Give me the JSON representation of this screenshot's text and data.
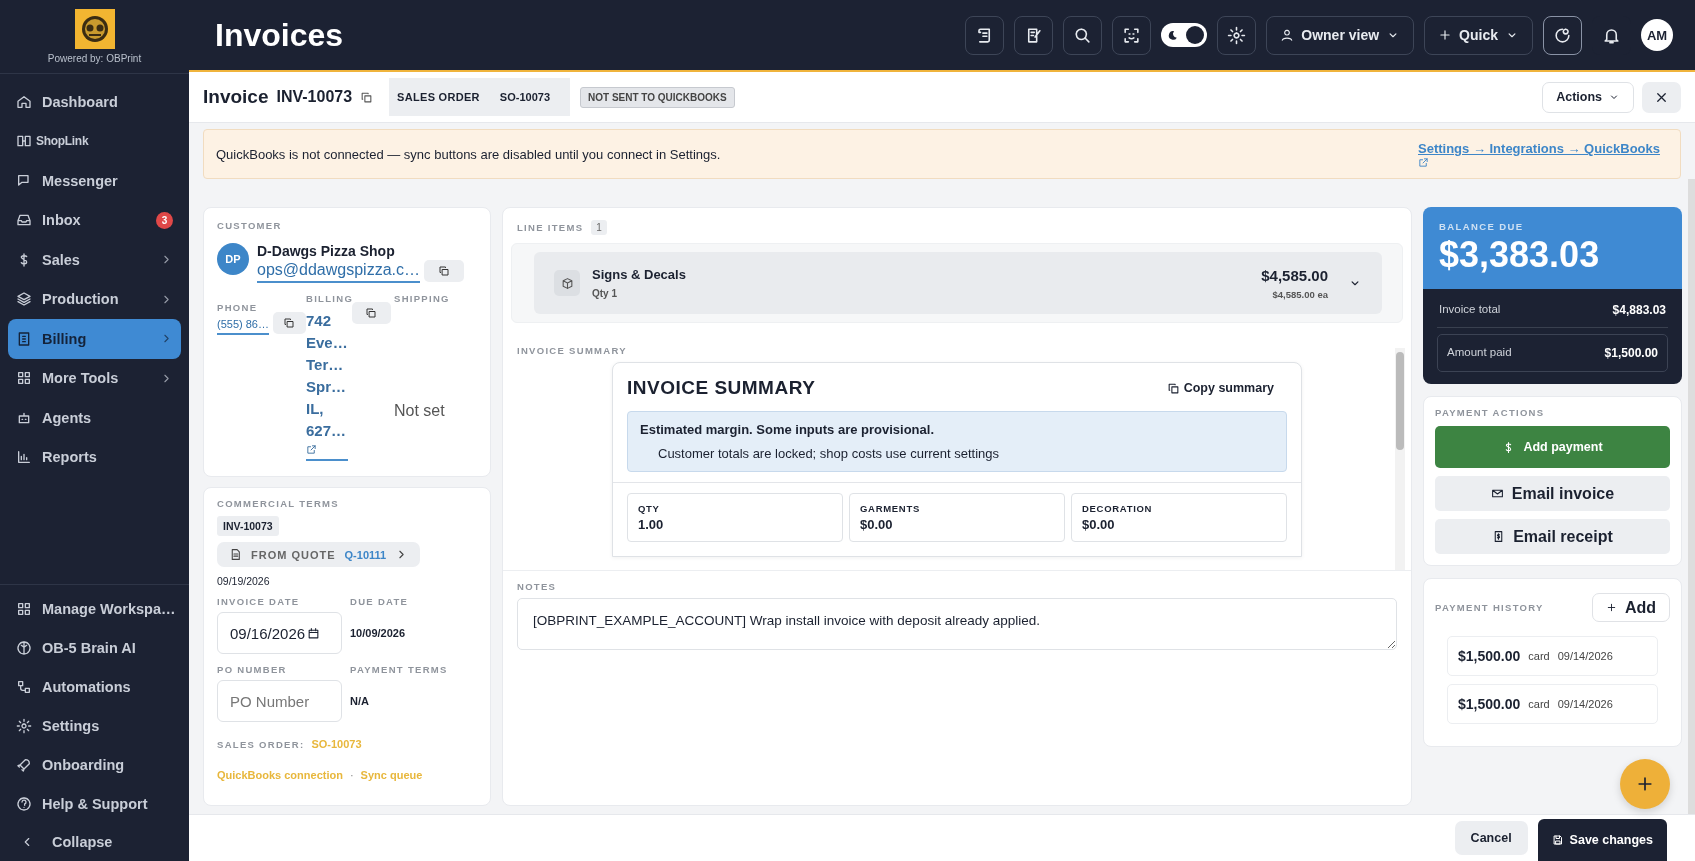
{
  "sidebar": {
    "tagline": "Powered by: OBPrint",
    "items": [
      {
        "label": "Dashboard",
        "kind": "link",
        "selected": false,
        "expandable": false
      },
      {
        "label": "ShopLink",
        "kind": "logo",
        "selected": false,
        "expandable": false
      },
      {
        "label": "Messenger",
        "kind": "link",
        "selected": false,
        "expandable": false
      },
      {
        "label": "Inbox",
        "kind": "link",
        "selected": false,
        "expandable": false,
        "badge": "3"
      },
      {
        "label": "Sales",
        "kind": "link",
        "selected": false,
        "expandable": true
      },
      {
        "label": "Production",
        "kind": "link",
        "selected": false,
        "expandable": true
      },
      {
        "label": "Billing",
        "kind": "link",
        "selected": true,
        "expandable": true
      },
      {
        "label": "More Tools",
        "kind": "link",
        "selected": false,
        "expandable": true
      },
      {
        "label": "Agents",
        "kind": "link",
        "selected": false,
        "expandable": false
      },
      {
        "label": "Reports",
        "kind": "link",
        "selected": false,
        "expandable": false
      }
    ],
    "bottom_items": [
      {
        "label": "Manage Workspa…"
      },
      {
        "label": "OB-5 Brain AI"
      },
      {
        "label": "Automations"
      },
      {
        "label": "Settings"
      },
      {
        "label": "Onboarding"
      },
      {
        "label": "Help & Support"
      }
    ],
    "collapse": "Collapse"
  },
  "header": {
    "title": "Invoices",
    "theme_toggle": {
      "on": true
    },
    "view_menu": "Owner view",
    "quick_menu": "Quick",
    "avatar": "AM"
  },
  "invoice": {
    "label": "Invoice",
    "number": "INV-10073",
    "sales_order_label": "SALES ORDER",
    "sales_order": "SO-10073",
    "sync_status": "NOT SENT TO QUICKBOOKS",
    "actions": "Actions"
  },
  "alert": {
    "message": "QuickBooks is not connected — sync buttons are disabled until you connect in Settings.",
    "link": "Settings → Integrations → QuickBooks"
  },
  "customer": {
    "title": "CUSTOMER",
    "initials": "DP",
    "name": "D-Dawgs Pizza Shop",
    "email": "ops@ddawgspizza.c…",
    "phone_label": "PHONE",
    "phone": "(555) 86…",
    "billing_label": "BILLING",
    "billing": "742 Eve… Ter… Spr… IL, 627…",
    "shipping_label": "SHIPPING",
    "shipping": "Not set"
  },
  "terms": {
    "title": "COMMERCIAL TERMS",
    "invoice_number": "INV-10073",
    "quote_label": "FROM QUOTE",
    "quote": "Q-10111",
    "quote_date": "09/19/2026",
    "invoice_date_label": "INVOICE DATE",
    "invoice_date": "09/16/2026",
    "due_date_label": "DUE DATE",
    "due_date": "10/09/2026",
    "po_label": "PO NUMBER",
    "po_placeholder": "PO Number",
    "payment_terms_label": "PAYMENT TERMS",
    "payment_terms": "N/A",
    "sales_order_label": "SALES ORDER:",
    "sales_order": "SO-10073",
    "qb_link": "QuickBooks connection",
    "separator": "·",
    "sync_link": "Sync queue"
  },
  "line_items": {
    "title": "LINE ITEMS",
    "count": "1",
    "items": [
      {
        "name": "Signs & Decals",
        "qty": "Qty 1",
        "total": "$4,585.00",
        "unit": "$4,585.00 ea",
        "expanded": false
      }
    ]
  },
  "summary": {
    "label": "INVOICE SUMMARY",
    "title": "INVOICE SUMMARY",
    "copy": "Copy summary",
    "note_title": "Estimated margin. Some inputs are provisional.",
    "note_body": "Customer totals are locked; shop costs use current settings",
    "stats": [
      {
        "label": "QTY",
        "value": "1.00"
      },
      {
        "label": "GARMENTS",
        "value": "$0.00"
      },
      {
        "label": "DECORATION",
        "value": "$0.00"
      }
    ]
  },
  "notes": {
    "label": "NOTES",
    "value": "[OBPRINT_EXAMPLE_ACCOUNT] Wrap install invoice with deposit already applied."
  },
  "balance": {
    "label": "BALANCE DUE",
    "amount": "$3,383.03",
    "total_label": "Invoice total",
    "total": "$4,883.03",
    "paid_label": "Amount paid",
    "paid": "$1,500.00"
  },
  "payment_actions": {
    "title": "PAYMENT ACTIONS",
    "buttons": [
      {
        "label": "Add payment",
        "kind": "primary"
      },
      {
        "label": "Email invoice",
        "kind": "secondary"
      },
      {
        "label": "Email receipt",
        "kind": "secondary"
      }
    ]
  },
  "payment_history": {
    "title": "PAYMENT HISTORY",
    "add": "Add",
    "payments": [
      {
        "amount": "$1,500.00",
        "method": "card",
        "date": "09/14/2026"
      },
      {
        "amount": "$1,500.00",
        "method": "card",
        "date": "09/14/2026"
      }
    ]
  },
  "footer": {
    "cancel": "Cancel",
    "save": "Save changes"
  }
}
